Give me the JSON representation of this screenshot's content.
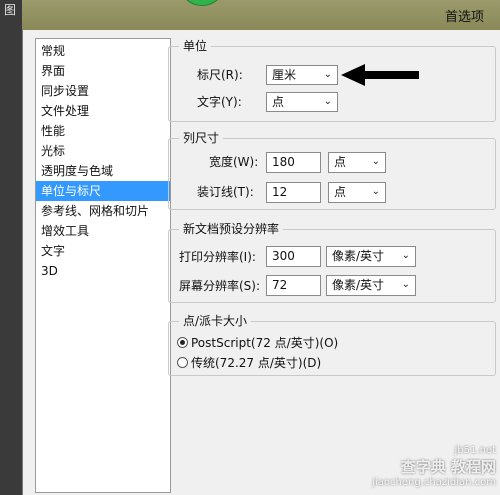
{
  "window": {
    "app_glyph": "图",
    "dialog_title": "首选项"
  },
  "categories": [
    {
      "label": "常规",
      "selected": false
    },
    {
      "label": "界面",
      "selected": false
    },
    {
      "label": "同步设置",
      "selected": false
    },
    {
      "label": "文件处理",
      "selected": false
    },
    {
      "label": "性能",
      "selected": false
    },
    {
      "label": "光标",
      "selected": false
    },
    {
      "label": "透明度与色域",
      "selected": false
    },
    {
      "label": "单位与标尺",
      "selected": true
    },
    {
      "label": "参考线、网格和切片",
      "selected": false
    },
    {
      "label": "增效工具",
      "selected": false
    },
    {
      "label": "文字",
      "selected": false
    },
    {
      "label": "3D",
      "selected": false
    }
  ],
  "units": {
    "group_label": "单位",
    "ruler_label": "标尺(R):",
    "ruler_value": "厘米",
    "type_label": "文字(Y):",
    "type_value": "点"
  },
  "column_size": {
    "group_label": "列尺寸",
    "width_label": "宽度(W):",
    "width_value": "180",
    "width_unit": "点",
    "gutter_label": "装订线(T):",
    "gutter_value": "12",
    "gutter_unit": "点"
  },
  "new_doc_resolution": {
    "group_label": "新文档预设分辨率",
    "print_label": "打印分辨率(I):",
    "print_value": "300",
    "print_unit": "像素/英寸",
    "screen_label": "屏幕分辨率(S):",
    "screen_value": "72",
    "screen_unit": "像素/英寸"
  },
  "point_pica": {
    "group_label": "点/派卡大小",
    "option_postscript": "PostScript(72 点/英寸)(O)",
    "option_traditional": "传统(72.27 点/英寸)(D)",
    "selected": "postscript"
  },
  "watermark": {
    "line1": "jb51.net",
    "line2": "查字典 教程网",
    "line3": "jiaocheng.chazidian.com"
  },
  "icons": {
    "dropdown": "chevron-down-icon",
    "annotation": "black-arrow-icon"
  }
}
